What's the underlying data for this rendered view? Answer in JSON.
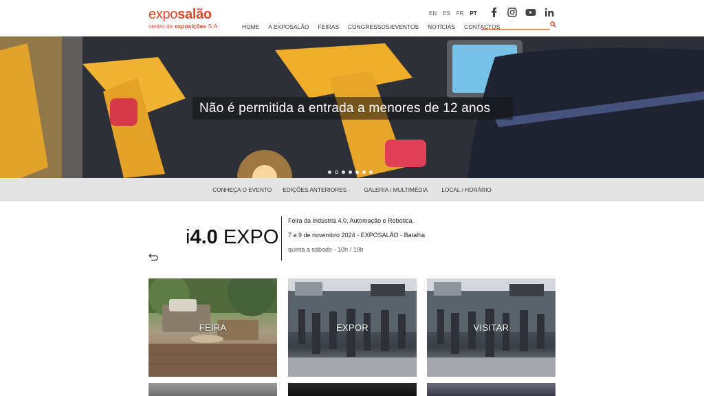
{
  "header": {
    "logo": {
      "main_a": "expo",
      "main_b": "salão",
      "sub_a": "centro de ",
      "sub_b": "exposições",
      "sub_c": " S.A"
    },
    "languages": [
      "EN",
      "ES",
      "FR",
      "PT"
    ],
    "active_language": "PT",
    "nav": [
      "HOME",
      "A EXPOSALÃO",
      "FEIRAS",
      "CONGRESSOS/EVENTOS",
      "NOTÍCIAS",
      "CONTACTOS"
    ],
    "social_icons": [
      "facebook-icon",
      "instagram-icon",
      "youtube-icon",
      "linkedin-icon"
    ],
    "search": {
      "value": "",
      "placeholder": ""
    },
    "accent_color": "#e2452a"
  },
  "hero": {
    "caption": "Não é permitida a entrada a menores de 12 anos",
    "slide_count": 7,
    "active_slide": 1
  },
  "subnav": {
    "items": [
      "CONHEÇA O EVENTO",
      "EDIÇÕES ANTERIORES",
      "GALERIA / MULTIMÉDIA",
      "LOCAL / HORÁRIO"
    ]
  },
  "event": {
    "logo_a": "i",
    "logo_b": "4.0",
    "logo_c": " EXPO",
    "line1": "Feira da Indústria 4.0, Automação e Robótica.",
    "line2": "7 a 9 de novembro 2024 - EXPOSALÃO - Batalha",
    "line3": "quinta a sábado - 10h / 19h"
  },
  "tiles": [
    {
      "label": "FEIRA"
    },
    {
      "label": "EXPOR"
    },
    {
      "label": "VISITAR"
    }
  ]
}
